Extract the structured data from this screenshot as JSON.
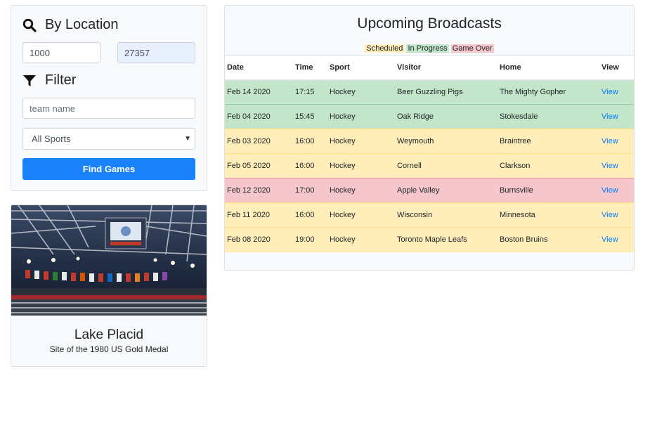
{
  "location": {
    "heading": "By Location",
    "distance_value": "1000",
    "zip_value": "27357"
  },
  "filter": {
    "heading": "Filter",
    "team_placeholder": "team name",
    "sport_selected": "All Sports",
    "find_button": "Find Games"
  },
  "feature": {
    "title": "Lake Placid",
    "subtitle": "Site of the 1980 US Gold Medal"
  },
  "broadcasts": {
    "title": "Upcoming Broadcasts",
    "legend": {
      "scheduled": "Scheduled",
      "in_progress": "In Progress",
      "game_over": "Game Over"
    },
    "columns": [
      "Date",
      "Time",
      "Sport",
      "Visitor",
      "Home",
      "View"
    ],
    "rows": [
      {
        "date": "Feb 14 2020",
        "time": "17:15",
        "sport": "Hockey",
        "visitor": "Beer Guzzling Pigs",
        "home": "The Mighty Gopher",
        "view": "View",
        "status": "progress"
      },
      {
        "date": "Feb 04 2020",
        "time": "15:45",
        "sport": "Hockey",
        "visitor": "Oak Ridge",
        "home": "Stokesdale",
        "view": "View",
        "status": "progress"
      },
      {
        "date": "Feb 03 2020",
        "time": "16:00",
        "sport": "Hockey",
        "visitor": "Weymouth",
        "home": "Braintree",
        "view": "View",
        "status": "scheduled"
      },
      {
        "date": "Feb 05 2020",
        "time": "16:00",
        "sport": "Hockey",
        "visitor": "Cornell",
        "home": "Clarkson",
        "view": "View",
        "status": "scheduled"
      },
      {
        "date": "Feb 12 2020",
        "time": "17:00",
        "sport": "Hockey",
        "visitor": "Apple Valley",
        "home": "Burnsville",
        "view": "View",
        "status": "over"
      },
      {
        "date": "Feb 11 2020",
        "time": "16:00",
        "sport": "Hockey",
        "visitor": "Wisconsin",
        "home": "Minnesota",
        "view": "View",
        "status": "scheduled"
      },
      {
        "date": "Feb 08 2020",
        "time": "19:00",
        "sport": "Hockey",
        "visitor": "Toronto Maple Leafs",
        "home": "Boston Bruins",
        "view": "View",
        "status": "scheduled"
      }
    ]
  },
  "colors": {
    "accent": "#1a82fb",
    "link": "#007bff",
    "scheduled": "#ffeeba",
    "in_progress": "#c3e6cb",
    "game_over": "#f5c6cb"
  },
  "icons": {
    "location_heading": "search-icon",
    "filter_heading": "filter-icon",
    "select": "caret-down-icon"
  }
}
